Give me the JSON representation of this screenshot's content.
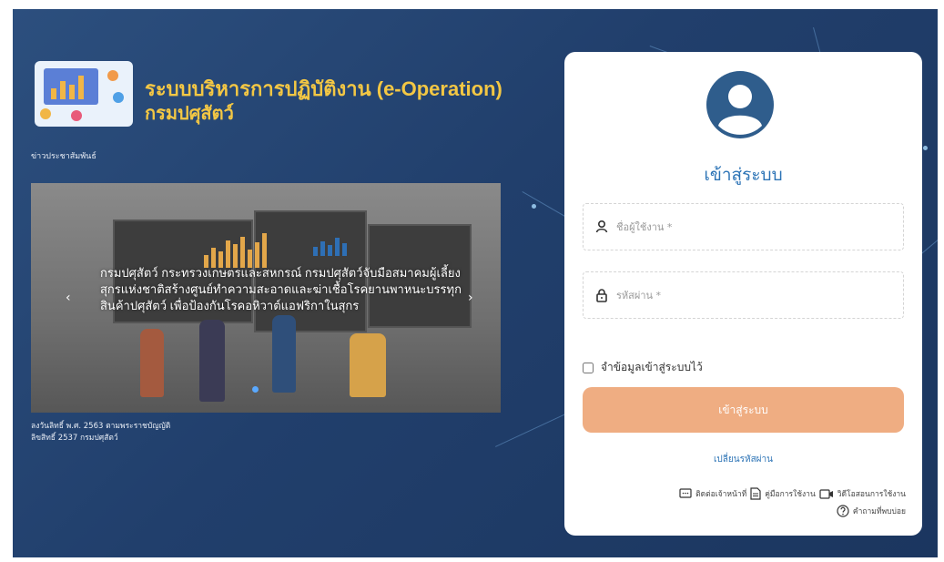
{
  "header": {
    "title_line1": "ระบบบริหารการปฏิบัติงาน (e-Operation)",
    "title_line2": "กรมปศุสัตว์"
  },
  "news": {
    "label": "ข่าวประชาสัมพันธ์",
    "banner_text": "กรมปศุสัตว์ กระทรวงเกษตรและสหกรณ์ กรมปศุสัตว์จับมือสมาคมผู้เลี้ยงสุกรแห่งชาติสร้างศูนย์ทำความสะอาดและฆ่าเชื้อโรคยานพาหนะบรรทุกสินค้าปศุสัตว์ เพื่อป้องกันโรคอหิวาต์แอฟริกาในสุกร",
    "prev_arrow": "‹",
    "next_arrow": "›"
  },
  "copyright": {
    "line1": "ลงวันลิทธิ์ พ.ศ. 2563 ตามพระราชบัญญัติ",
    "line2": "ลิขสิทธิ์ 2537 กรมปศุสัตว์"
  },
  "login": {
    "title": "เข้าสู่ระบบ",
    "username_placeholder": "ชื่อผู้ใช้งาน *",
    "password_placeholder": "รหัสผ่าน *",
    "remember_label": "จำข้อมูลเข้าสู่ระบบไว้",
    "submit_label": "เข้าสู่ระบบ",
    "change_password": "เปลี่ยนรหัสผ่าน"
  },
  "help": {
    "contact": "ติดต่อเจ้าหน้าที่",
    "manual": "คู่มือการใช้งาน",
    "video": "วิดีโอสอนการใช้งาน",
    "faq": "คำถามที่พบบ่อย"
  },
  "colors": {
    "accent": "#2d74b6",
    "title_gold": "#f3c744",
    "button": "#efad82",
    "background": "#213f6c"
  }
}
